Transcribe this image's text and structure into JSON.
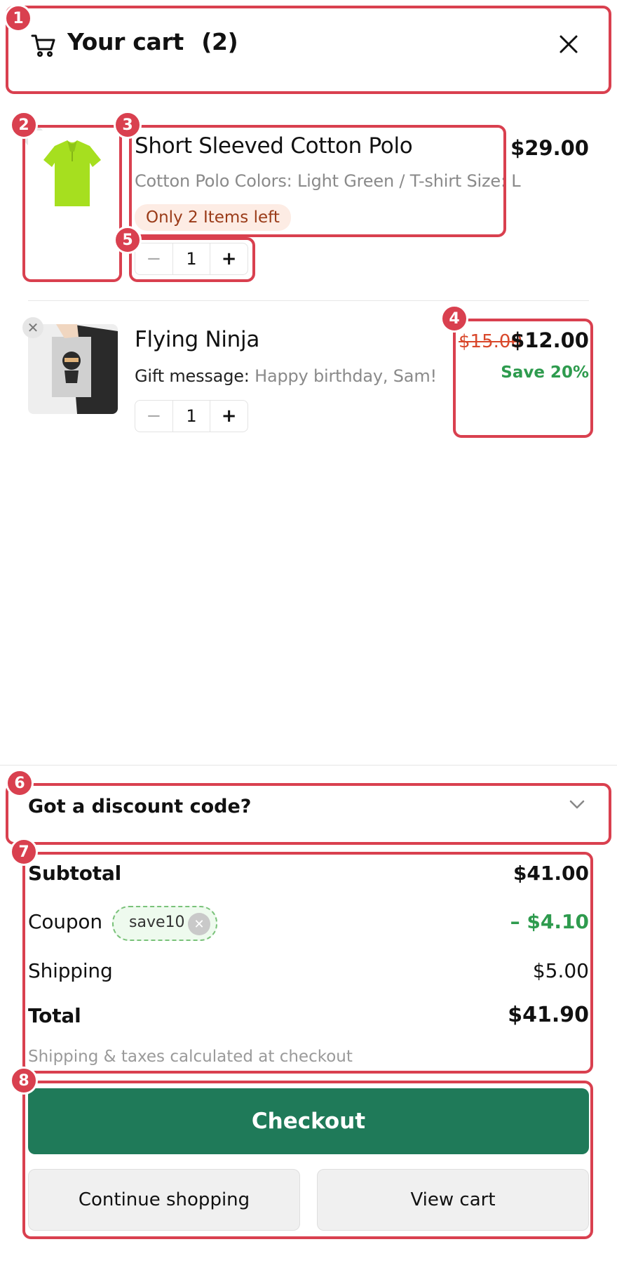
{
  "header": {
    "title": "Your cart",
    "count": "(2)",
    "cart_icon": "cart-icon",
    "close_icon": "close-icon"
  },
  "items": [
    {
      "title": "Short Sleeved Cotton Polo",
      "options": "Cotton Polo Colors: Light Green / T-shirt Size: L",
      "stock_notice": "Only 2 Items left",
      "price": "$29.00",
      "quantity": "1",
      "image": "green-polo-shirt"
    },
    {
      "title": "Flying Ninja",
      "gift_label": "Gift message:",
      "gift_message": "Happy birthday, Sam!",
      "original_price": "$15.00",
      "price": "$12.00",
      "savings": "Save 20%",
      "quantity": "1",
      "image": "ninja-poster"
    }
  ],
  "discount": {
    "label": "Got a discount code?",
    "icon": "chevron-down-icon"
  },
  "summary": {
    "subtotal_label": "Subtotal",
    "subtotal_value": "$41.00",
    "coupon_label": "Coupon",
    "coupon_code": "save10",
    "coupon_value": "– $4.10",
    "shipping_label": "Shipping",
    "shipping_value": "$5.00",
    "total_label": "Total",
    "total_value": "$41.90",
    "note": "Shipping & taxes calculated at checkout"
  },
  "actions": {
    "checkout": "Checkout",
    "continue_shopping": "Continue shopping",
    "view_cart": "View cart"
  },
  "annotations": [
    "1",
    "2",
    "3",
    "4",
    "5",
    "6",
    "7",
    "8"
  ],
  "colors": {
    "accent": "#1f7a59",
    "annotation": "#d9404f",
    "discount_green": "#2e9b4e",
    "strike_red": "#d9482b"
  }
}
